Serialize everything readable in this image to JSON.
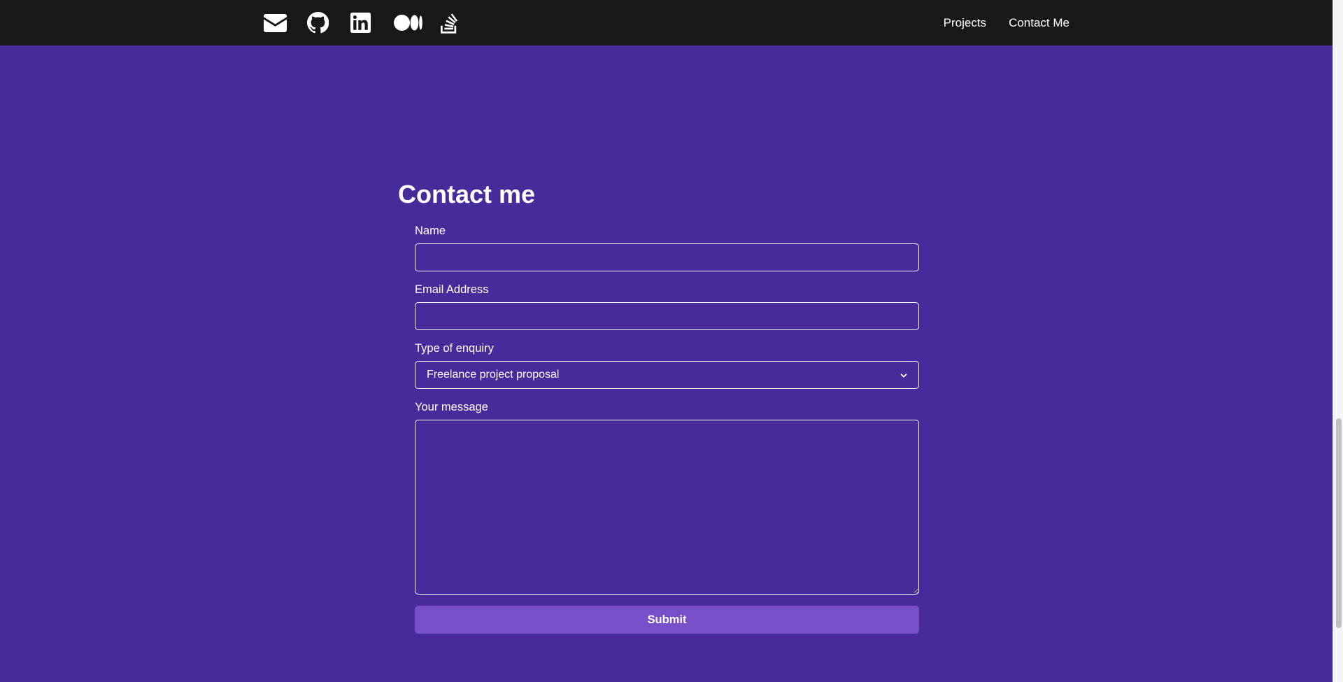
{
  "nav": {
    "social_icons": [
      "envelope-icon",
      "github-icon",
      "linkedin-icon",
      "medium-icon",
      "stack-overflow-icon"
    ],
    "links": [
      "Projects",
      "Contact Me"
    ]
  },
  "contact": {
    "title": "Contact me",
    "name_label": "Name",
    "name_value": "",
    "email_label": "Email Address",
    "email_value": "",
    "enquiry_label": "Type of enquiry",
    "enquiry_selected": "Freelance project proposal",
    "message_label": "Your message",
    "message_value": "",
    "submit_label": "Submit"
  },
  "colors": {
    "background": "#482b9a",
    "navbar": "#18181b",
    "button": "#7750c9",
    "text": "#ffffff"
  }
}
